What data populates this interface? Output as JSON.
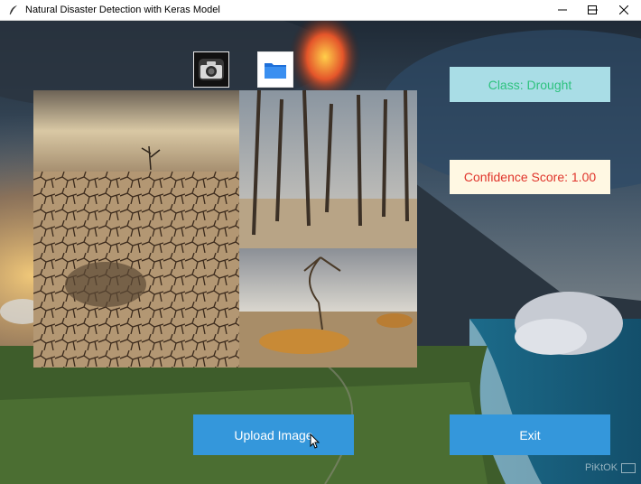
{
  "window": {
    "title": "Natural Disaster Detection with Keras Model",
    "icon": "feather-icon",
    "controls": [
      "minimize-icon",
      "maximize-icon",
      "close-icon"
    ]
  },
  "toolbar": {
    "camera_icon": "camera-icon",
    "folder_icon": "folder-icon"
  },
  "result": {
    "class_text": "Class: Drought",
    "confidence_text": "Confidence Score: 1.00"
  },
  "buttons": {
    "upload_label": "Upload Image",
    "exit_label": "Exit"
  },
  "watermark": {
    "text": "PiKtOK"
  },
  "colors": {
    "button_bg": "#3497db",
    "class_bg": "#a9dde6",
    "class_text": "#2ec27e",
    "confidence_bg": "#fff8e3",
    "confidence_text": "#e0342b"
  }
}
